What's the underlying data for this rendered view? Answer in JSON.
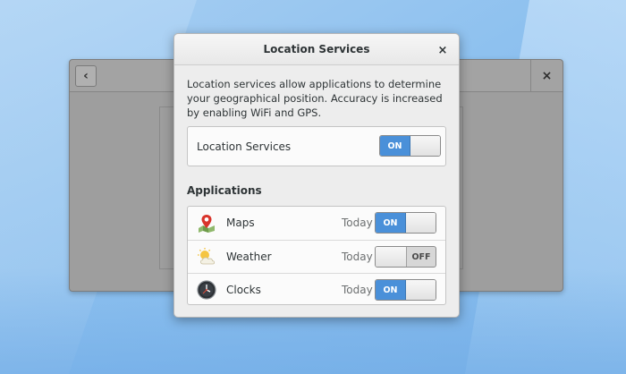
{
  "background_window": {
    "back_icon": "chevron-left-icon",
    "close_icon": "close-icon",
    "close_glyph": "×",
    "back_glyph": "‹"
  },
  "dialog": {
    "title": "Location Services",
    "close_glyph": "×",
    "description": "Location services allow applications to determine your geographical position. Accuracy is increased by enabling WiFi and GPS.",
    "location_services": {
      "label": "Location Services",
      "state": "ON"
    },
    "applications_heading": "Applications",
    "apps": [
      {
        "name": "Maps",
        "last_used": "Today",
        "state": "ON",
        "icon": "maps-icon"
      },
      {
        "name": "Weather",
        "last_used": "Today",
        "state": "OFF",
        "icon": "weather-icon"
      },
      {
        "name": "Clocks",
        "last_used": "Today",
        "state": "ON",
        "icon": "clocks-icon"
      }
    ]
  },
  "colors": {
    "accent": "#4a90d9",
    "dialog_bg": "#ededed",
    "dim_window": "#9e9e9e"
  }
}
